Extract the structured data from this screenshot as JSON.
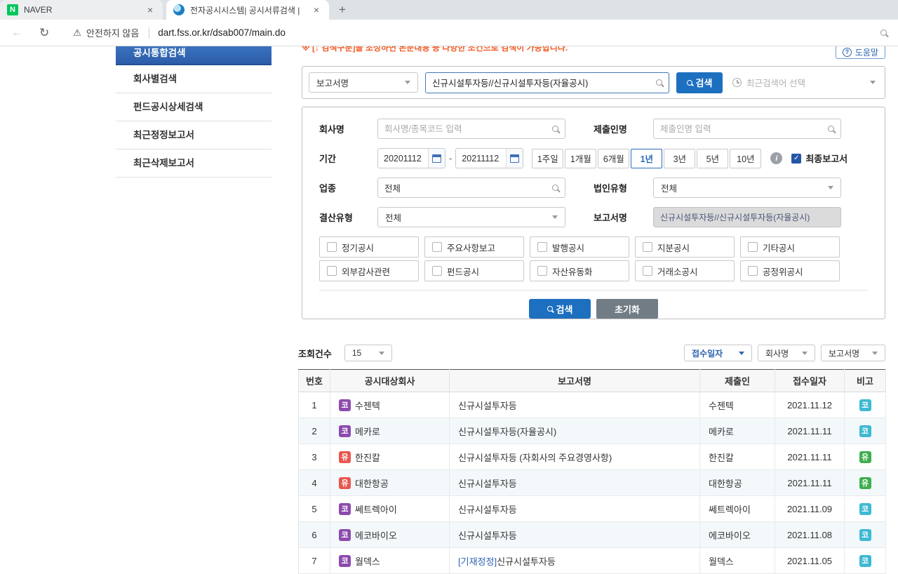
{
  "colors": {
    "accent_blue": "#1d6fc0",
    "link_blue": "#2e64b2",
    "notice_orange": "#f15a22",
    "kosdaq_purple": "#8c4bae",
    "kospi_red": "#e8564e",
    "kosdaq_cyan": "#3fb9d3",
    "kospi_green": "#3fae4e"
  },
  "browser": {
    "tab1": "NAVER",
    "tab2": "전자공시시스템| 공시서류검색 |",
    "warning": "안전하지 않음",
    "url": "dart.fss.or.kr/dsab007/main.do"
  },
  "sidebar": {
    "items": [
      {
        "label": "공시통합검색"
      },
      {
        "label": "회사별검색"
      },
      {
        "label": "펀드공시상세검색"
      },
      {
        "label": "최근정정보고서"
      },
      {
        "label": "최근삭제보고서"
      }
    ]
  },
  "main": {
    "notice": "※ [↓ 검색구분]을 조성하면 본문내용 등 다양한 조건으로 검색이 가능합니다.",
    "help": "도움말"
  },
  "search": {
    "category": "보고서명",
    "query": "신규시설투자등//신규시설투자등(자율공시)",
    "button": "검색",
    "recent": "최근검색어 선택"
  },
  "filters": {
    "company_label": "회사명",
    "company_placeholder": "회사명/종목코드 입력",
    "submitter_label": "제출인명",
    "submitter_placeholder": "제출인명 입력",
    "period_label": "기간",
    "date_from": "20201112",
    "date_to": "20211112",
    "period_buttons": [
      "1주일",
      "1개월",
      "6개월",
      "1년",
      "3년",
      "5년",
      "10년"
    ],
    "period_selected": "1년",
    "final_label": "최종보고서",
    "industry_label": "업종",
    "industry_value": "전체",
    "corp_label": "법인유형",
    "corp_value": "전체",
    "settle_label": "결산유형",
    "settle_value": "전체",
    "report_label": "보고서명",
    "report_value": "신규시설투자등//신규시설투자등(자율공시)",
    "checks1": [
      "정기공시",
      "주요사항보고",
      "발행공시",
      "지분공시",
      "기타공시"
    ],
    "checks2": [
      "외부감사관련",
      "펀드공시",
      "자산유동화",
      "거래소공시",
      "공정위공시"
    ],
    "search_btn": "검색",
    "reset_btn": "초기화"
  },
  "results": {
    "count_label": "조회건수",
    "count_value": "15",
    "sort1": "접수일자",
    "sort2": "회사명",
    "sort3": "보고서명",
    "headers": [
      "번호",
      "공시대상회사",
      "보고서명",
      "제출인",
      "접수일자",
      "비고"
    ],
    "rows": [
      {
        "no": "1",
        "market": "코",
        "market_class": "kosdaq",
        "company": "수젠텍",
        "report": "신규시설투자등",
        "submitter": "수젠텍",
        "date": "2021.11.12",
        "remark": "코"
      },
      {
        "no": "2",
        "market": "코",
        "market_class": "kosdaq",
        "company": "메카로",
        "report": "신규시설투자등(자율공시)",
        "submitter": "메카로",
        "date": "2021.11.11",
        "remark": "코"
      },
      {
        "no": "3",
        "market": "유",
        "market_class": "kospi",
        "company": "한진칼",
        "report": "신규시설투자등 (자회사의 주요경영사항)",
        "submitter": "한진칼",
        "date": "2021.11.11",
        "remark": "유"
      },
      {
        "no": "4",
        "market": "유",
        "market_class": "kospi",
        "company": "대한항공",
        "report": "신규시설투자등",
        "submitter": "대한항공",
        "date": "2021.11.11",
        "remark": "유"
      },
      {
        "no": "5",
        "market": "코",
        "market_class": "kosdaq",
        "company": "쎄트렉아이",
        "report": "신규시설투자등",
        "submitter": "쎄트렉아이",
        "date": "2021.11.09",
        "remark": "코"
      },
      {
        "no": "6",
        "market": "코",
        "market_class": "kosdaq",
        "company": "에코바이오",
        "report": "신규시설투자등",
        "submitter": "에코바이오",
        "date": "2021.11.08",
        "remark": "코"
      },
      {
        "no": "7",
        "market": "코",
        "market_class": "kosdaq",
        "company": "월덱스",
        "report_prefix": "[기재정정]",
        "report": "신규시설투자등",
        "submitter": "월덱스",
        "date": "2021.11.05",
        "remark": "코"
      }
    ]
  }
}
